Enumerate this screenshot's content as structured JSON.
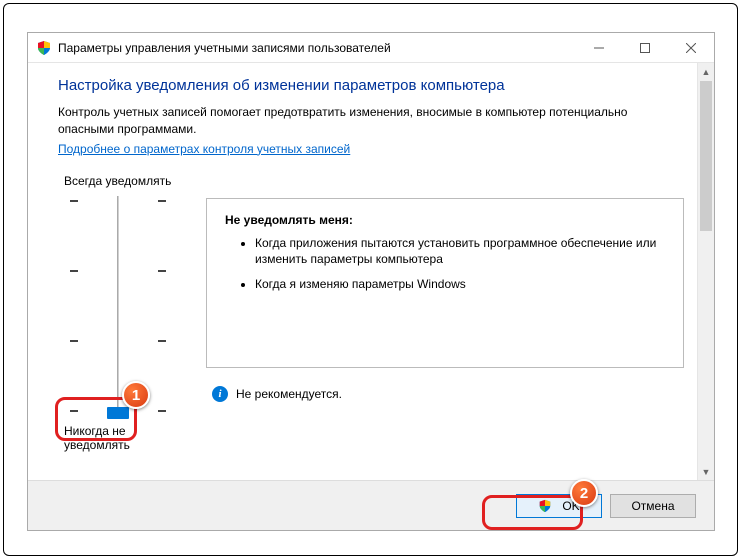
{
  "window": {
    "title": "Параметры управления учетными записями пользователей"
  },
  "content": {
    "heading": "Настройка уведомления об изменении параметров компьютера",
    "subtext": "Контроль учетных записей помогает предотвратить изменения, вносимые в компьютер потенциально опасными программами.",
    "link": "Подробнее о параметрах контроля учетных записей",
    "slider_top_label": "Всегда уведомлять",
    "slider_bottom_label": "Никогда не уведомлять",
    "info_title": "Не уведомлять меня:",
    "info_bullets": [
      "Когда приложения пытаются установить программное обеспечение или изменить параметры компьютера",
      "Когда я изменяю параметры Windows"
    ],
    "recommend": "Не рекомендуется."
  },
  "footer": {
    "ok": "OK",
    "cancel": "Отмена"
  },
  "callouts": {
    "b1": "1",
    "b2": "2"
  }
}
